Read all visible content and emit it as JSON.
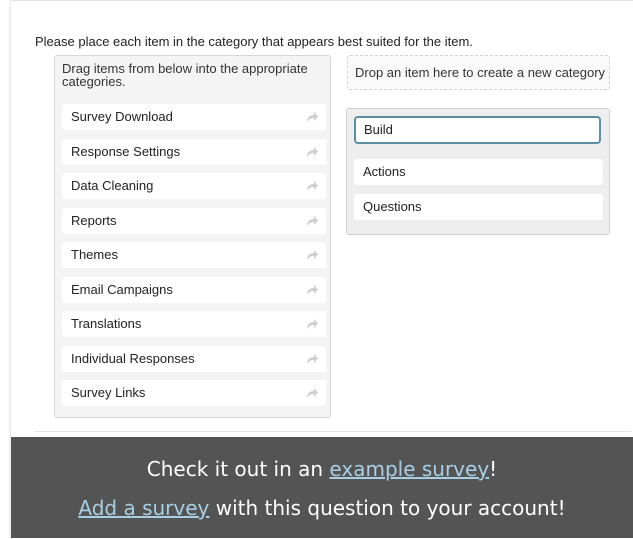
{
  "question": {
    "prompt": "Please place each item in the category that appears best suited for the item."
  },
  "source": {
    "header": "Drag items from below into the appropriate categories.",
    "items": [
      {
        "label": "Survey Download"
      },
      {
        "label": "Response Settings"
      },
      {
        "label": "Data Cleaning"
      },
      {
        "label": "Reports"
      },
      {
        "label": "Themes"
      },
      {
        "label": "Email Campaigns"
      },
      {
        "label": "Translations"
      },
      {
        "label": "Individual Responses"
      },
      {
        "label": "Survey Links"
      }
    ]
  },
  "new_category": {
    "label": "Drop an item here to create a new category"
  },
  "category": {
    "title": "Build",
    "items": [
      {
        "label": "Actions"
      },
      {
        "label": "Questions"
      }
    ]
  },
  "footer": {
    "line1_prefix": "Check it out in an ",
    "line1_link": "example survey",
    "line1_suffix": "!",
    "line2_link": "Add a survey",
    "line2_suffix": " with this question to your account!"
  },
  "colors": {
    "footer_bg": "#545454",
    "link": "#a8cfe4",
    "category_title_border": "#5a8fa1"
  },
  "icons": {
    "item_handle": "share-arrow-icon"
  }
}
